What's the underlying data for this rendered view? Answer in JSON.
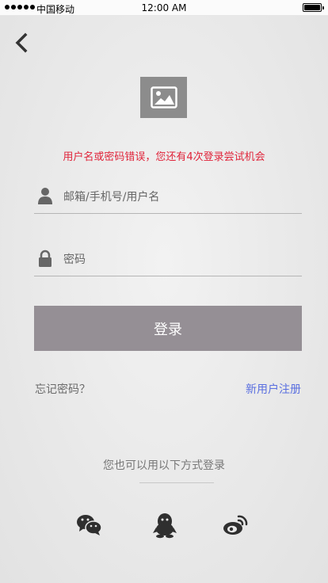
{
  "status_bar": {
    "carrier": "中国移动",
    "time": "12:00 AM"
  },
  "error_message": "用户名或密码错误，您还有4次登录尝试机会",
  "form": {
    "username_placeholder": "邮箱/手机号/用户名",
    "password_placeholder": "密码",
    "login_label": "登录"
  },
  "links": {
    "forgot_password": "忘记密码？",
    "register": "新用户注册"
  },
  "alt_login": {
    "title": "您也可以用以下方式登录",
    "providers": [
      "wechat",
      "qq",
      "weibo"
    ]
  },
  "colors": {
    "error": "#e0243a",
    "button": "#958f95",
    "link": "#5a6fe0"
  }
}
